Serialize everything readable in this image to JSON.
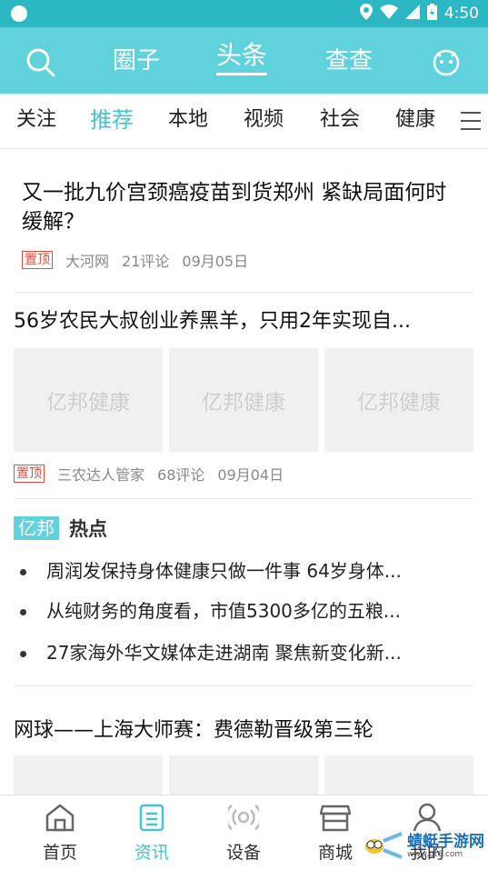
{
  "status": {
    "time": "4:50"
  },
  "topbar": {
    "tabs": [
      {
        "label": "圈子"
      },
      {
        "label": "头条"
      },
      {
        "label": "查查"
      }
    ],
    "active": "头条"
  },
  "categories": [
    "关注",
    "推荐",
    "本地",
    "视频",
    "社会",
    "健康"
  ],
  "active_category": "推荐",
  "feed": {
    "article1": {
      "title": "又一批九价宫颈癌疫苗到货郑州 紧缺局面何时缓解？",
      "pin": "置顶",
      "source": "大河网",
      "comments": "21评论",
      "date": "09月05日"
    },
    "article2": {
      "title": "56岁农民大叔创业养黑羊，只用2年实现自...",
      "pin": "置顶",
      "source": "三农达人管家",
      "comments": "68评论",
      "date": "09月04日",
      "thumb_text": "亿邦健康"
    },
    "hot": {
      "badge": "亿邦",
      "title": "热点",
      "items": [
        "周润发保持身体健康只做一件事 64岁身体...",
        "从纯财务的角度看，市值5300多亿的五粮...",
        "27家海外华文媒体走进湖南 聚焦新变化新..."
      ]
    },
    "article3": {
      "title": "网球——上海大师赛：费德勒晋级第三轮"
    }
  },
  "bottom_nav": [
    {
      "label": "首页",
      "icon": "home-icon"
    },
    {
      "label": "资讯",
      "icon": "news-icon"
    },
    {
      "label": "设备",
      "icon": "device-icon"
    },
    {
      "label": "商城",
      "icon": "shop-icon"
    },
    {
      "label": "我的",
      "icon": "user-icon"
    }
  ],
  "watermark": {
    "text": "蜻蜓手游网",
    "sub": "www.qt6.com"
  },
  "colors": {
    "accent": "#5fd2dc",
    "status": "#2cb8c2",
    "active_text": "#46c3d0",
    "pin": "#e74c3c"
  }
}
